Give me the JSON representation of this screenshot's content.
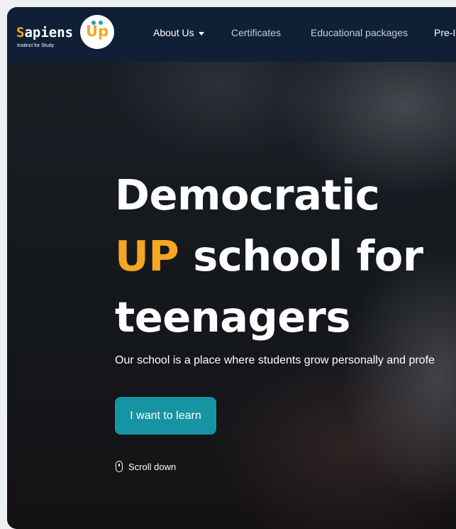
{
  "logo": {
    "brand_first_letter": "S",
    "brand_rest": "apiens",
    "badge_text": "Up",
    "tagline": "Instinct for Study"
  },
  "nav": {
    "items": [
      {
        "label": "About Us",
        "has_dropdown": true
      },
      {
        "label": "Certificates"
      },
      {
        "label": "Educational packages"
      },
      {
        "label": "Pre-I"
      }
    ]
  },
  "hero": {
    "title_line1": "Democratic",
    "title_accent": "UP",
    "title_line2_rest": " school for",
    "title_line3": "teenagers",
    "subtitle": "Our school is a place where students grow personally and profe",
    "cta_label": "I want to learn",
    "scroll_label": "Scroll down"
  },
  "colors": {
    "accent": "#f5a623",
    "nav_bg": "#0f1f36",
    "button": "#1794a4"
  },
  "icons": [
    "caret-down-icon",
    "mouse-icon"
  ]
}
